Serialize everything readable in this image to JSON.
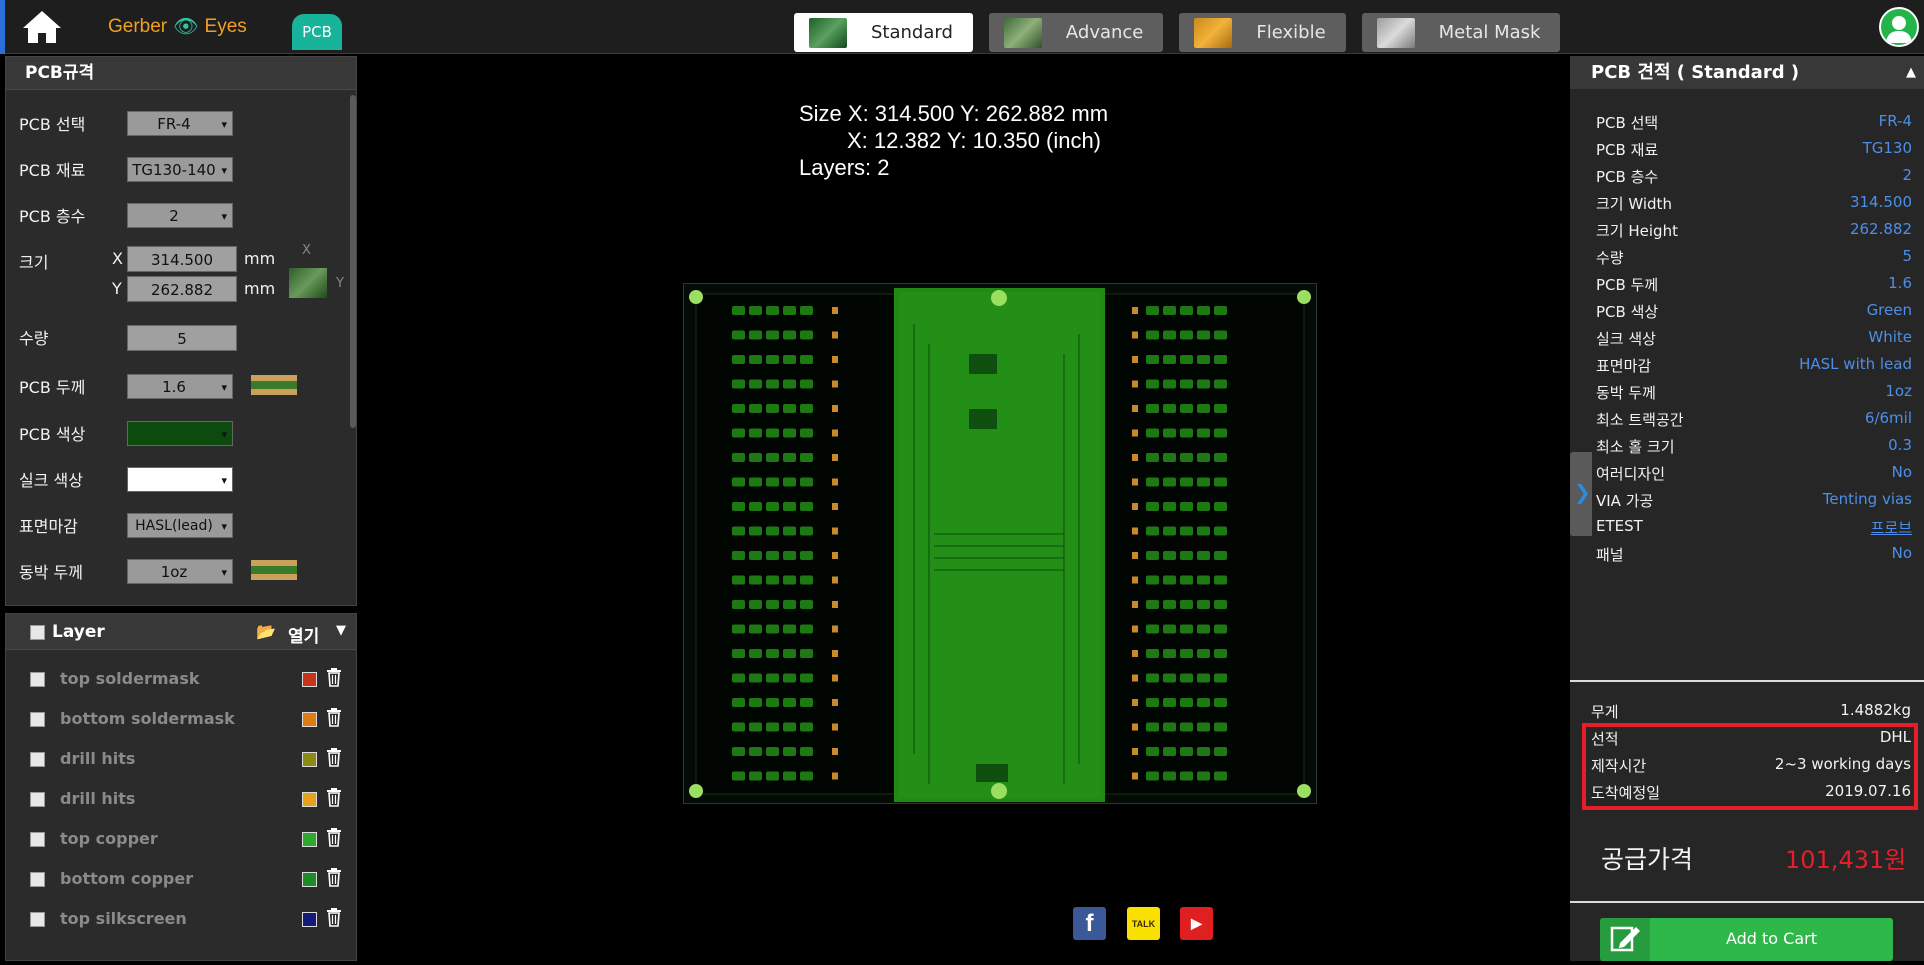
{
  "brand": {
    "part1": "Gerber",
    "part2": "Eyes"
  },
  "badge": "PCB",
  "tabs": [
    {
      "label": "Standard",
      "active": true
    },
    {
      "label": "Advance",
      "active": false
    },
    {
      "label": "Flexible",
      "active": false
    },
    {
      "label": "Metal Mask",
      "active": false
    }
  ],
  "spec": {
    "title": "PCB규격",
    "pcb_select_label": "PCB 선택",
    "pcb_select_value": "FR-4",
    "material_label": "PCB 재료",
    "material_value": "TG130-140",
    "layers_label": "PCB 층수",
    "layers_value": "2",
    "size_label": "크기",
    "x_label": "X",
    "x_value": "314.500",
    "x_unit": "mm",
    "y_label": "Y",
    "y_value": "262.882",
    "y_unit": "mm",
    "dim_x": "X",
    "dim_y": "Y",
    "qty_label": "수량",
    "qty_value": "5",
    "thickness_label": "PCB 두께",
    "thickness_value": "1.6",
    "color_label": "PCB 색상",
    "color_value": "#0d4a0d",
    "silk_label": "실크 색상",
    "silk_value": "#ffffff",
    "finish_label": "표면마감",
    "finish_value": "HASL(lead)",
    "copper_label": "동박 두께",
    "copper_value": "1oz"
  },
  "layers": {
    "title": "Layer",
    "open_label": "열기",
    "items": [
      {
        "name": "top soldermask",
        "color": "#c8341a"
      },
      {
        "name": "bottom soldermask",
        "color": "#e07a16"
      },
      {
        "name": "drill hits",
        "color": "#8a8a14"
      },
      {
        "name": "drill hits",
        "color": "#e6a21c"
      },
      {
        "name": "top copper",
        "color": "#2ea82e"
      },
      {
        "name": "bottom copper",
        "color": "#1f8a2a"
      },
      {
        "name": "top silkscreen",
        "color": "#141a7a"
      }
    ]
  },
  "size_info": {
    "line1": "Size X: 314.500 Y: 262.882 mm",
    "line2": "X: 12.382 Y: 10.350 (inch)",
    "line3": "Layers: 2"
  },
  "quote": {
    "title": "PCB 견적 ( Standard )",
    "rows": [
      {
        "k": "PCB 선택",
        "v": "FR-4"
      },
      {
        "k": "PCB 재료",
        "v": "TG130"
      },
      {
        "k": "PCB 층수",
        "v": "2"
      },
      {
        "k": "크기 Width",
        "v": "314.500"
      },
      {
        "k": "크기 Height",
        "v": "262.882"
      },
      {
        "k": "수량",
        "v": "5"
      },
      {
        "k": "PCB 두께",
        "v": "1.6"
      },
      {
        "k": "PCB 색상",
        "v": "Green"
      },
      {
        "k": "실크 색상",
        "v": "White"
      },
      {
        "k": "표면마감",
        "v": "HASL with lead"
      },
      {
        "k": "동박 두께",
        "v": "1oz"
      },
      {
        "k": "최소 트랙공간",
        "v": "6/6mil"
      },
      {
        "k": "최소 홀 크기",
        "v": "0.3"
      },
      {
        "k": "여러디자인",
        "v": "No"
      },
      {
        "k": "VIA 가공",
        "v": "Tenting vias"
      },
      {
        "k": "ETEST",
        "v": "프로브"
      },
      {
        "k": "패널",
        "v": "No"
      }
    ]
  },
  "shipping": {
    "weight_label": "무게",
    "weight_value": "1.4882kg",
    "carrier_label": "선적",
    "carrier_value": "DHL",
    "lead_label": "제작시간",
    "lead_value": "2~3 working days",
    "arrival_label": "도착예정일",
    "arrival_value": "2019.07.16"
  },
  "price": {
    "label": "공급가격",
    "value": "101,431원"
  },
  "cart_label": "Add to Cart",
  "social": [
    {
      "name": "facebook",
      "glyph": "f",
      "color": "#3b5998"
    },
    {
      "name": "kakaotalk",
      "glyph": "TALK",
      "color": "#f9e000"
    },
    {
      "name": "youtube",
      "glyph": "▶",
      "color": "#e02020"
    }
  ]
}
